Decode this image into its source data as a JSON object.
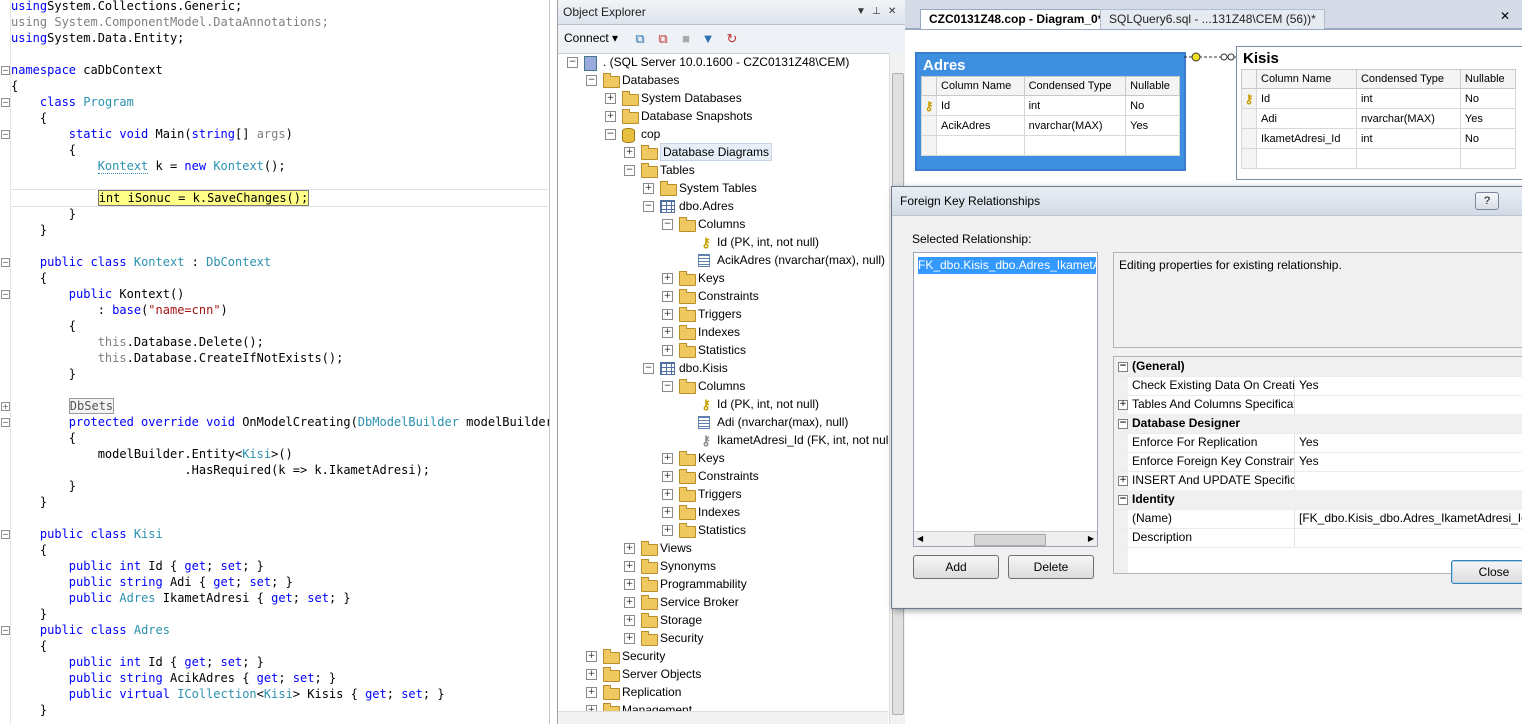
{
  "code": {
    "lines": [
      [
        [
          "kw",
          "using"
        ],
        [
          "",
          "System.Collections.Generic;"
        ]
      ],
      [
        [
          "gr",
          "using System.ComponentModel.DataAnnotations;"
        ]
      ],
      [
        [
          "kw",
          "using"
        ],
        [
          "",
          "System.Data.Entity;"
        ]
      ],
      [],
      [
        [
          "kw",
          "namespace"
        ],
        [
          "",
          " caDbContext"
        ]
      ],
      [
        [
          "",
          "{"
        ]
      ],
      [
        [
          "",
          "    "
        ],
        [
          "kw",
          "class"
        ],
        [
          "",
          " "
        ],
        [
          "ty",
          "Program"
        ]
      ],
      [
        [
          "",
          "    {"
        ]
      ],
      [
        [
          "",
          "        "
        ],
        [
          "kw",
          "static void"
        ],
        [
          "",
          " Main("
        ],
        [
          "kw",
          "string"
        ],
        [
          "",
          "[] "
        ],
        [
          "gr",
          "args"
        ],
        [
          "",
          ")"
        ]
      ],
      [
        [
          "",
          "        {"
        ]
      ],
      [
        [
          "",
          "            "
        ],
        [
          "tysq",
          "Kontext"
        ],
        [
          "",
          " k = "
        ],
        [
          "kw",
          "new"
        ],
        [
          "",
          " "
        ],
        [
          "ty",
          "Kontext"
        ],
        [
          "",
          "();"
        ]
      ],
      [],
      [
        [
          "",
          "            "
        ],
        [
          "hl",
          "int iSonuc = k.SaveChanges();"
        ]
      ],
      [
        [
          "",
          "        }"
        ]
      ],
      [
        [
          "",
          "    }"
        ]
      ],
      [],
      [
        [
          "",
          "    "
        ],
        [
          "kw",
          "public class"
        ],
        [
          "",
          " "
        ],
        [
          "ty",
          "Kontext"
        ],
        [
          "",
          " : "
        ],
        [
          "ty",
          "DbContext"
        ]
      ],
      [
        [
          "",
          "    {"
        ]
      ],
      [
        [
          "",
          "        "
        ],
        [
          "kw",
          "public"
        ],
        [
          "",
          " Kontext()"
        ]
      ],
      [
        [
          "",
          "            : "
        ],
        [
          "kw",
          "base"
        ],
        [
          "",
          "("
        ],
        [
          "st",
          "\"name=cnn\""
        ],
        [
          "",
          ")"
        ]
      ],
      [
        [
          "",
          "        {"
        ]
      ],
      [
        [
          "",
          "            "
        ],
        [
          "gr",
          "this"
        ],
        [
          "",
          ".Database.Delete();"
        ]
      ],
      [
        [
          "",
          "            "
        ],
        [
          "gr",
          "this"
        ],
        [
          "",
          ".Database.CreateIfNotExists();"
        ]
      ],
      [
        [
          "",
          "        }"
        ]
      ],
      [],
      [
        [
          "",
          "        "
        ],
        [
          "rg",
          "DbSets"
        ]
      ],
      [
        [
          "",
          "        "
        ],
        [
          "kw",
          "protected override void"
        ],
        [
          "",
          " OnModelCreating("
        ],
        [
          "ty",
          "DbModelBuilder"
        ],
        [
          "",
          " modelBuilder)"
        ]
      ],
      [
        [
          "",
          "        {"
        ]
      ],
      [
        [
          "",
          "            modelBuilder.Entity<"
        ],
        [
          "ty",
          "Kisi"
        ],
        [
          "",
          ">()"
        ]
      ],
      [
        [
          "",
          "                        .HasRequired(k => k.IkametAdresi);"
        ]
      ],
      [
        [
          "",
          "        }"
        ]
      ],
      [
        [
          "",
          "    }"
        ]
      ],
      [],
      [
        [
          "",
          "    "
        ],
        [
          "kw",
          "public class"
        ],
        [
          "",
          " "
        ],
        [
          "ty",
          "Kisi"
        ]
      ],
      [
        [
          "",
          "    {"
        ]
      ],
      [
        [
          "",
          "        "
        ],
        [
          "kw",
          "public int"
        ],
        [
          "",
          " Id { "
        ],
        [
          "kw",
          "get"
        ],
        [
          "",
          "; "
        ],
        [
          "kw",
          "set"
        ],
        [
          "",
          "; }"
        ]
      ],
      [
        [
          "",
          "        "
        ],
        [
          "kw",
          "public string"
        ],
        [
          "",
          " Adi { "
        ],
        [
          "kw",
          "get"
        ],
        [
          "",
          "; "
        ],
        [
          "kw",
          "set"
        ],
        [
          "",
          "; }"
        ]
      ],
      [
        [
          "",
          "        "
        ],
        [
          "kw",
          "public"
        ],
        [
          "",
          " "
        ],
        [
          "ty",
          "Adres"
        ],
        [
          "",
          " IkametAdresi { "
        ],
        [
          "kw",
          "get"
        ],
        [
          "",
          "; "
        ],
        [
          "kw",
          "set"
        ],
        [
          "",
          "; }"
        ]
      ],
      [
        [
          "",
          "    }"
        ]
      ],
      [
        [
          "",
          "    "
        ],
        [
          "kw",
          "public class"
        ],
        [
          "",
          " "
        ],
        [
          "ty",
          "Adres"
        ]
      ],
      [
        [
          "",
          "    {"
        ]
      ],
      [
        [
          "",
          "        "
        ],
        [
          "kw",
          "public int"
        ],
        [
          "",
          " Id { "
        ],
        [
          "kw",
          "get"
        ],
        [
          "",
          "; "
        ],
        [
          "kw",
          "set"
        ],
        [
          "",
          "; }"
        ]
      ],
      [
        [
          "",
          "        "
        ],
        [
          "kw",
          "public string"
        ],
        [
          "",
          " AcikAdres { "
        ],
        [
          "kw",
          "get"
        ],
        [
          "",
          "; "
        ],
        [
          "kw",
          "set"
        ],
        [
          "",
          "; }"
        ]
      ],
      [
        [
          "",
          "        "
        ],
        [
          "kw",
          "public virtual"
        ],
        [
          "",
          " "
        ],
        [
          "ty",
          "ICollection"
        ],
        [
          "",
          "<"
        ],
        [
          "ty",
          "Kisi"
        ],
        [
          "",
          "> Kisis { "
        ],
        [
          "kw",
          "get"
        ],
        [
          "",
          "; "
        ],
        [
          "kw",
          "set"
        ],
        [
          "",
          "; }"
        ]
      ],
      [
        [
          "",
          "    }"
        ]
      ]
    ]
  },
  "object_explorer": {
    "title": "Object Explorer",
    "connect_label": "Connect",
    "tree": [
      {
        "depth": 0,
        "exp": "-",
        "icon": "srv",
        "label": ". (SQL Server 10.0.1600 - CZC0131Z48\\CEM)"
      },
      {
        "depth": 1,
        "exp": "-",
        "icon": "folder",
        "label": "Databases"
      },
      {
        "depth": 2,
        "exp": "+",
        "icon": "folder",
        "label": "System Databases"
      },
      {
        "depth": 2,
        "exp": "+",
        "icon": "folder",
        "label": "Database Snapshots"
      },
      {
        "depth": 2,
        "exp": "-",
        "icon": "db",
        "label": "cop"
      },
      {
        "depth": 3,
        "exp": "+",
        "icon": "folder",
        "label": "Database Diagrams",
        "selected": true
      },
      {
        "depth": 3,
        "exp": "-",
        "icon": "folder",
        "label": "Tables"
      },
      {
        "depth": 4,
        "exp": "+",
        "icon": "folder",
        "label": "System Tables"
      },
      {
        "depth": 4,
        "exp": "-",
        "icon": "tbl",
        "label": "dbo.Adres"
      },
      {
        "depth": 5,
        "exp": "-",
        "icon": "folder",
        "label": "Columns"
      },
      {
        "depth": 6,
        "exp": "",
        "icon": "key",
        "label": "Id (PK, int, not null)"
      },
      {
        "depth": 6,
        "exp": "",
        "icon": "col",
        "label": "AcikAdres (nvarchar(max), null)"
      },
      {
        "depth": 5,
        "exp": "+",
        "icon": "folder",
        "label": "Keys"
      },
      {
        "depth": 5,
        "exp": "+",
        "icon": "folder",
        "label": "Constraints"
      },
      {
        "depth": 5,
        "exp": "+",
        "icon": "folder",
        "label": "Triggers"
      },
      {
        "depth": 5,
        "exp": "+",
        "icon": "folder",
        "label": "Indexes"
      },
      {
        "depth": 5,
        "exp": "+",
        "icon": "folder",
        "label": "Statistics"
      },
      {
        "depth": 4,
        "exp": "-",
        "icon": "tbl",
        "label": "dbo.Kisis"
      },
      {
        "depth": 5,
        "exp": "-",
        "icon": "folder",
        "label": "Columns"
      },
      {
        "depth": 6,
        "exp": "",
        "icon": "key",
        "label": "Id (PK, int, not null)"
      },
      {
        "depth": 6,
        "exp": "",
        "icon": "col",
        "label": "Adi (nvarchar(max), null)"
      },
      {
        "depth": 6,
        "exp": "",
        "icon": "fkey",
        "label": "IkametAdresi_Id (FK, int, not null)"
      },
      {
        "depth": 5,
        "exp": "+",
        "icon": "folder",
        "label": "Keys"
      },
      {
        "depth": 5,
        "exp": "+",
        "icon": "folder",
        "label": "Constraints"
      },
      {
        "depth": 5,
        "exp": "+",
        "icon": "folder",
        "label": "Triggers"
      },
      {
        "depth": 5,
        "exp": "+",
        "icon": "folder",
        "label": "Indexes"
      },
      {
        "depth": 5,
        "exp": "+",
        "icon": "folder",
        "label": "Statistics"
      },
      {
        "depth": 3,
        "exp": "+",
        "icon": "folder",
        "label": "Views"
      },
      {
        "depth": 3,
        "exp": "+",
        "icon": "folder",
        "label": "Synonyms"
      },
      {
        "depth": 3,
        "exp": "+",
        "icon": "folder",
        "label": "Programmability"
      },
      {
        "depth": 3,
        "exp": "+",
        "icon": "folder",
        "label": "Service Broker"
      },
      {
        "depth": 3,
        "exp": "+",
        "icon": "folder",
        "label": "Storage"
      },
      {
        "depth": 3,
        "exp": "+",
        "icon": "folder",
        "label": "Security"
      },
      {
        "depth": 1,
        "exp": "+",
        "icon": "folder",
        "label": "Security"
      },
      {
        "depth": 1,
        "exp": "+",
        "icon": "folder",
        "label": "Server Objects"
      },
      {
        "depth": 1,
        "exp": "+",
        "icon": "folder",
        "label": "Replication"
      },
      {
        "depth": 1,
        "exp": "+",
        "icon": "folder",
        "label": "Management"
      }
    ]
  },
  "doc_tabs": {
    "active": "CZC0131Z48.cop - Diagram_0*",
    "inactive": "SQLQuery6.sql - ...131Z48\\CEM (56))*",
    "close": "✕"
  },
  "diagram": {
    "headers": [
      "Column Name",
      "Condensed Type",
      "Nullable"
    ],
    "adres": {
      "title": "Adres",
      "rows": [
        [
          "Id",
          "int",
          "No"
        ],
        [
          "AcikAdres",
          "nvarchar(MAX)",
          "Yes"
        ],
        [
          "",
          "",
          ""
        ]
      ]
    },
    "kisis": {
      "title": "Kisis",
      "rows": [
        [
          "Id",
          "int",
          "No"
        ],
        [
          "Adi",
          "nvarchar(MAX)",
          "Yes"
        ],
        [
          "IkametAdresi_Id",
          "int",
          "No"
        ],
        [
          "",
          "",
          ""
        ]
      ]
    }
  },
  "dialog": {
    "title": "Foreign Key Relationships",
    "help": "?",
    "selected_label": "Selected Relationship:",
    "selected_item": "FK_dbo.Kisis_dbo.Adres_IkametAdresi_Id",
    "description": "Editing properties for existing relationship.",
    "properties": [
      {
        "type": "cat",
        "key": "(General)",
        "exp": "-"
      },
      {
        "type": "prop",
        "key": "Check Existing Data On Creation Or Re-Enabling",
        "val": "Yes"
      },
      {
        "type": "prop",
        "key": "Tables And Columns Specification",
        "val": "",
        "exp": "+"
      },
      {
        "type": "cat",
        "key": "Database Designer",
        "exp": "-"
      },
      {
        "type": "prop",
        "key": "Enforce For Replication",
        "val": "Yes"
      },
      {
        "type": "prop",
        "key": "Enforce Foreign Key Constraint",
        "val": "Yes"
      },
      {
        "type": "prop",
        "key": "INSERT And UPDATE Specification",
        "val": "",
        "exp": "+"
      },
      {
        "type": "cat",
        "key": "Identity",
        "exp": "-"
      },
      {
        "type": "prop",
        "key": "(Name)",
        "val": "[FK_dbo.Kisis_dbo.Adres_IkametAdresi_Id]"
      },
      {
        "type": "prop",
        "key": "Description",
        "val": ""
      }
    ],
    "add_label": "Add",
    "delete_label": "Delete",
    "close_label": "Close"
  }
}
